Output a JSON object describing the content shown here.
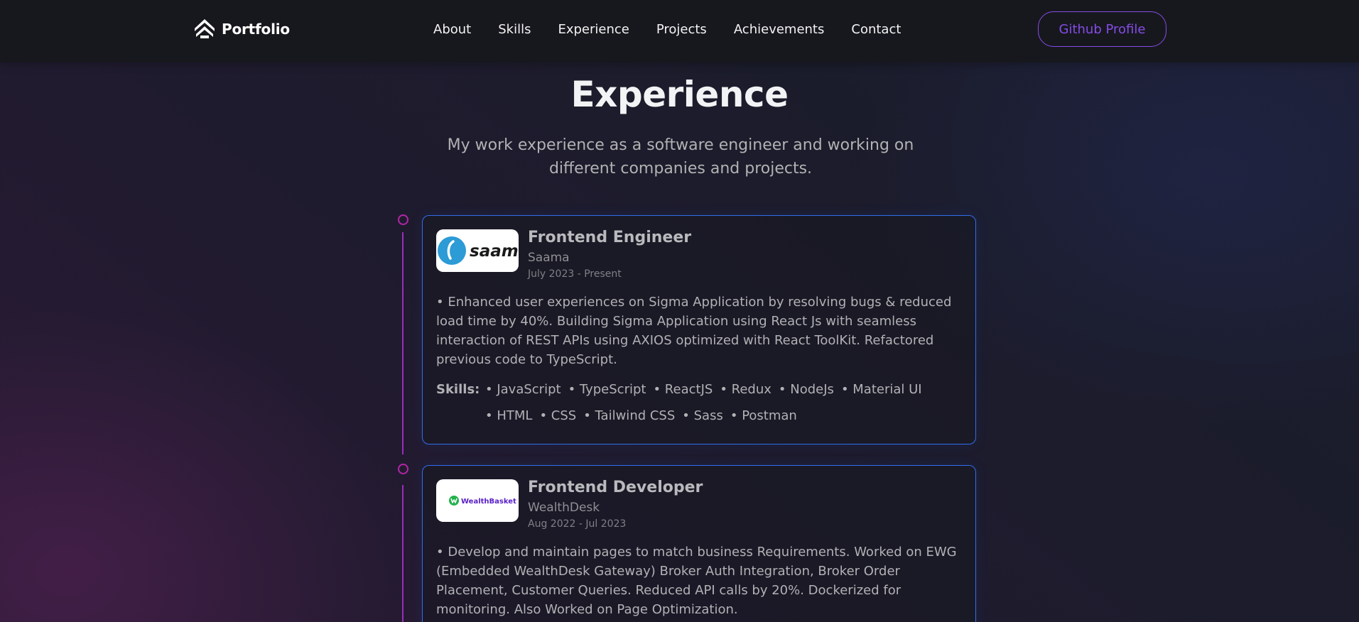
{
  "nav": {
    "logo_text": "Portfolio",
    "links": [
      "About",
      "Skills",
      "Experience",
      "Projects",
      "Achievements",
      "Contact"
    ],
    "github_button": "Github Profile"
  },
  "header": {
    "title": "Experience",
    "description": "My work experience as a software engineer and working on different companies and projects."
  },
  "experiences": [
    {
      "role": "Frontend Engineer",
      "company": "Saama",
      "date": "July 2023 - Present",
      "logo_text": "saama",
      "description": "• Enhanced user experiences on Sigma Application by resolving bugs & reduced load time by 40%. Building Sigma Application using React Js with seamless interaction of REST APIs using AXIOS optimized with React ToolKit. Refactored previous code to TypeScript.",
      "skills_label": "Skills:",
      "skills_row1": [
        "• JavaScript",
        "• TypeScript",
        "• ReactJS",
        "• Redux",
        "• NodeJs",
        "• Material UI"
      ],
      "skills_row2": [
        "• HTML",
        "• CSS",
        "• Tailwind CSS",
        "• Sass",
        "• Postman"
      ]
    },
    {
      "role": "Frontend Developer",
      "company": "WealthDesk",
      "date": "Aug 2022 - Jul 2023",
      "logo_text": "WealthBasket",
      "description": "• Develop and maintain pages to match business Requirements. Worked on EWG (Embedded WealthDesk Gateway) Broker Auth Integration, Broker Order Placement, Customer Queries. Reduced API calls by 20%. Dockerized for monitoring. Also Worked on Page Optimization."
    }
  ],
  "colors": {
    "accent": "#854ce6",
    "card_border": "#306ee8",
    "timeline": "#b325a9",
    "saama_blue": "#2c9bd6",
    "wealthbasket_green": "#21b24b",
    "wealthbasket_purple": "#5a20c8"
  },
  "icons": {
    "logo": "house-chevron-icon"
  }
}
